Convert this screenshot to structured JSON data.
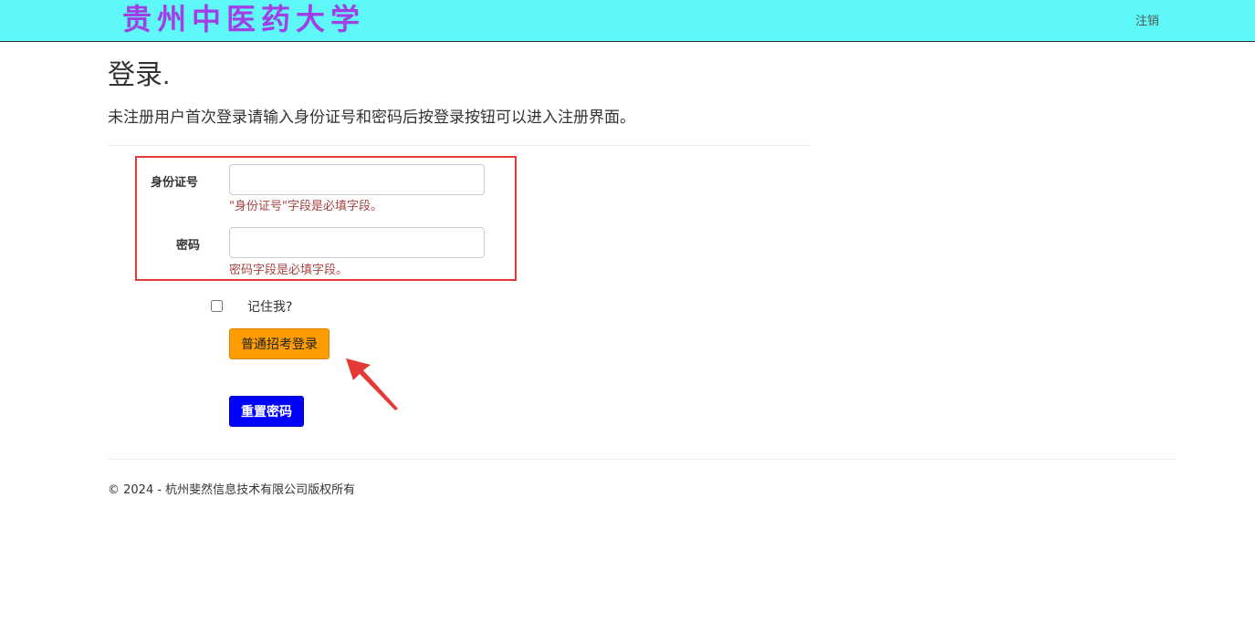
{
  "header": {
    "brand": "贵州中医药大学",
    "logout_label": "注销",
    "background_color": "#5ff8f8",
    "brand_color": "#a23ee6"
  },
  "main": {
    "title": "登录.",
    "instruction": "未注册用户首次登录请输入身份证号和密码后按登录按钮可以进入注册界面。"
  },
  "form": {
    "id_label": "身份证号",
    "id_value": "",
    "id_error": "\"身份证号\"字段是必填字段。",
    "password_label": "密码",
    "password_value": "",
    "password_error": "密码字段是必填字段。",
    "remember_label": "记住我?",
    "remember_checked": false,
    "login_button": "普通招考登录",
    "reset_button": "重置密码",
    "highlight_color": "#e53935"
  },
  "icons": {
    "annotation_arrow": "arrow-pointing-up-left-icon"
  },
  "footer": {
    "copyright": "© 2024 - 杭州斐然信息技术有限公司版权所有"
  }
}
